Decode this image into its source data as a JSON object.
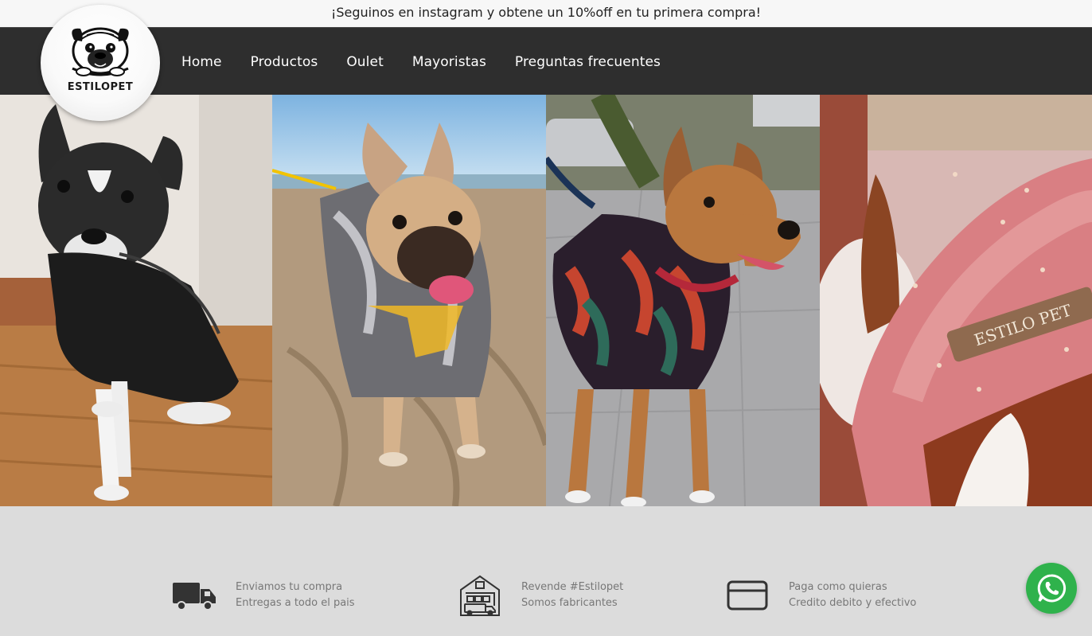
{
  "announcement": "¡Seguinos en instagram y obtene un 10%off en tu primera compra!",
  "brand": {
    "name": "ESTILOPET",
    "logo_icon": "pug-logo-icon"
  },
  "nav": {
    "items": [
      {
        "label": "Home"
      },
      {
        "label": "Productos"
      },
      {
        "label": "Oulet"
      },
      {
        "label": "Mayoristas"
      },
      {
        "label": "Preguntas frecuentes"
      }
    ]
  },
  "gallery": {
    "images": [
      {
        "subject": "french-bulldog-black-jacket"
      },
      {
        "subject": "pug-beach-hoodie"
      },
      {
        "subject": "dog-tropical-shirt"
      },
      {
        "subject": "pink-fleece-blanket",
        "tag_text": "ESTILO PET"
      }
    ]
  },
  "features": [
    {
      "icon": "truck-icon",
      "line1": "Enviamos tu compra",
      "line2": "Entregas a todo el pais"
    },
    {
      "icon": "warehouse-icon",
      "line1": "Revende #Estilopet",
      "line2": "Somos fabricantes"
    },
    {
      "icon": "credit-card-icon",
      "line1": "Paga como quieras",
      "line2": "Credito debito y efectivo"
    }
  ],
  "whatsapp": {
    "icon": "whatsapp-icon"
  },
  "colors": {
    "nav_bg": "#2e2e2e",
    "features_bg": "#dcdcdc",
    "whatsapp": "#2fb24c"
  }
}
